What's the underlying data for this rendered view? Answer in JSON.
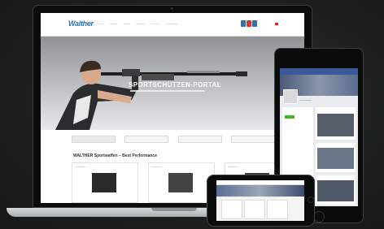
{
  "website": {
    "logo": "Walther",
    "hero_title": "SPORTSCHÜTZEN-PORTAL",
    "section_title": "WALTHER Sportwaffen – Best Performance"
  },
  "colors": {
    "logo_blue": "#1f73c4",
    "facebook_blue": "#3b5998",
    "flag_colors": [
      "#2f6fb5",
      "#d23a2a",
      "#2f6fb5"
    ]
  },
  "icons": {
    "laptop": "laptop-device",
    "tablet": "tablet-device",
    "phone": "smartphone-device"
  }
}
